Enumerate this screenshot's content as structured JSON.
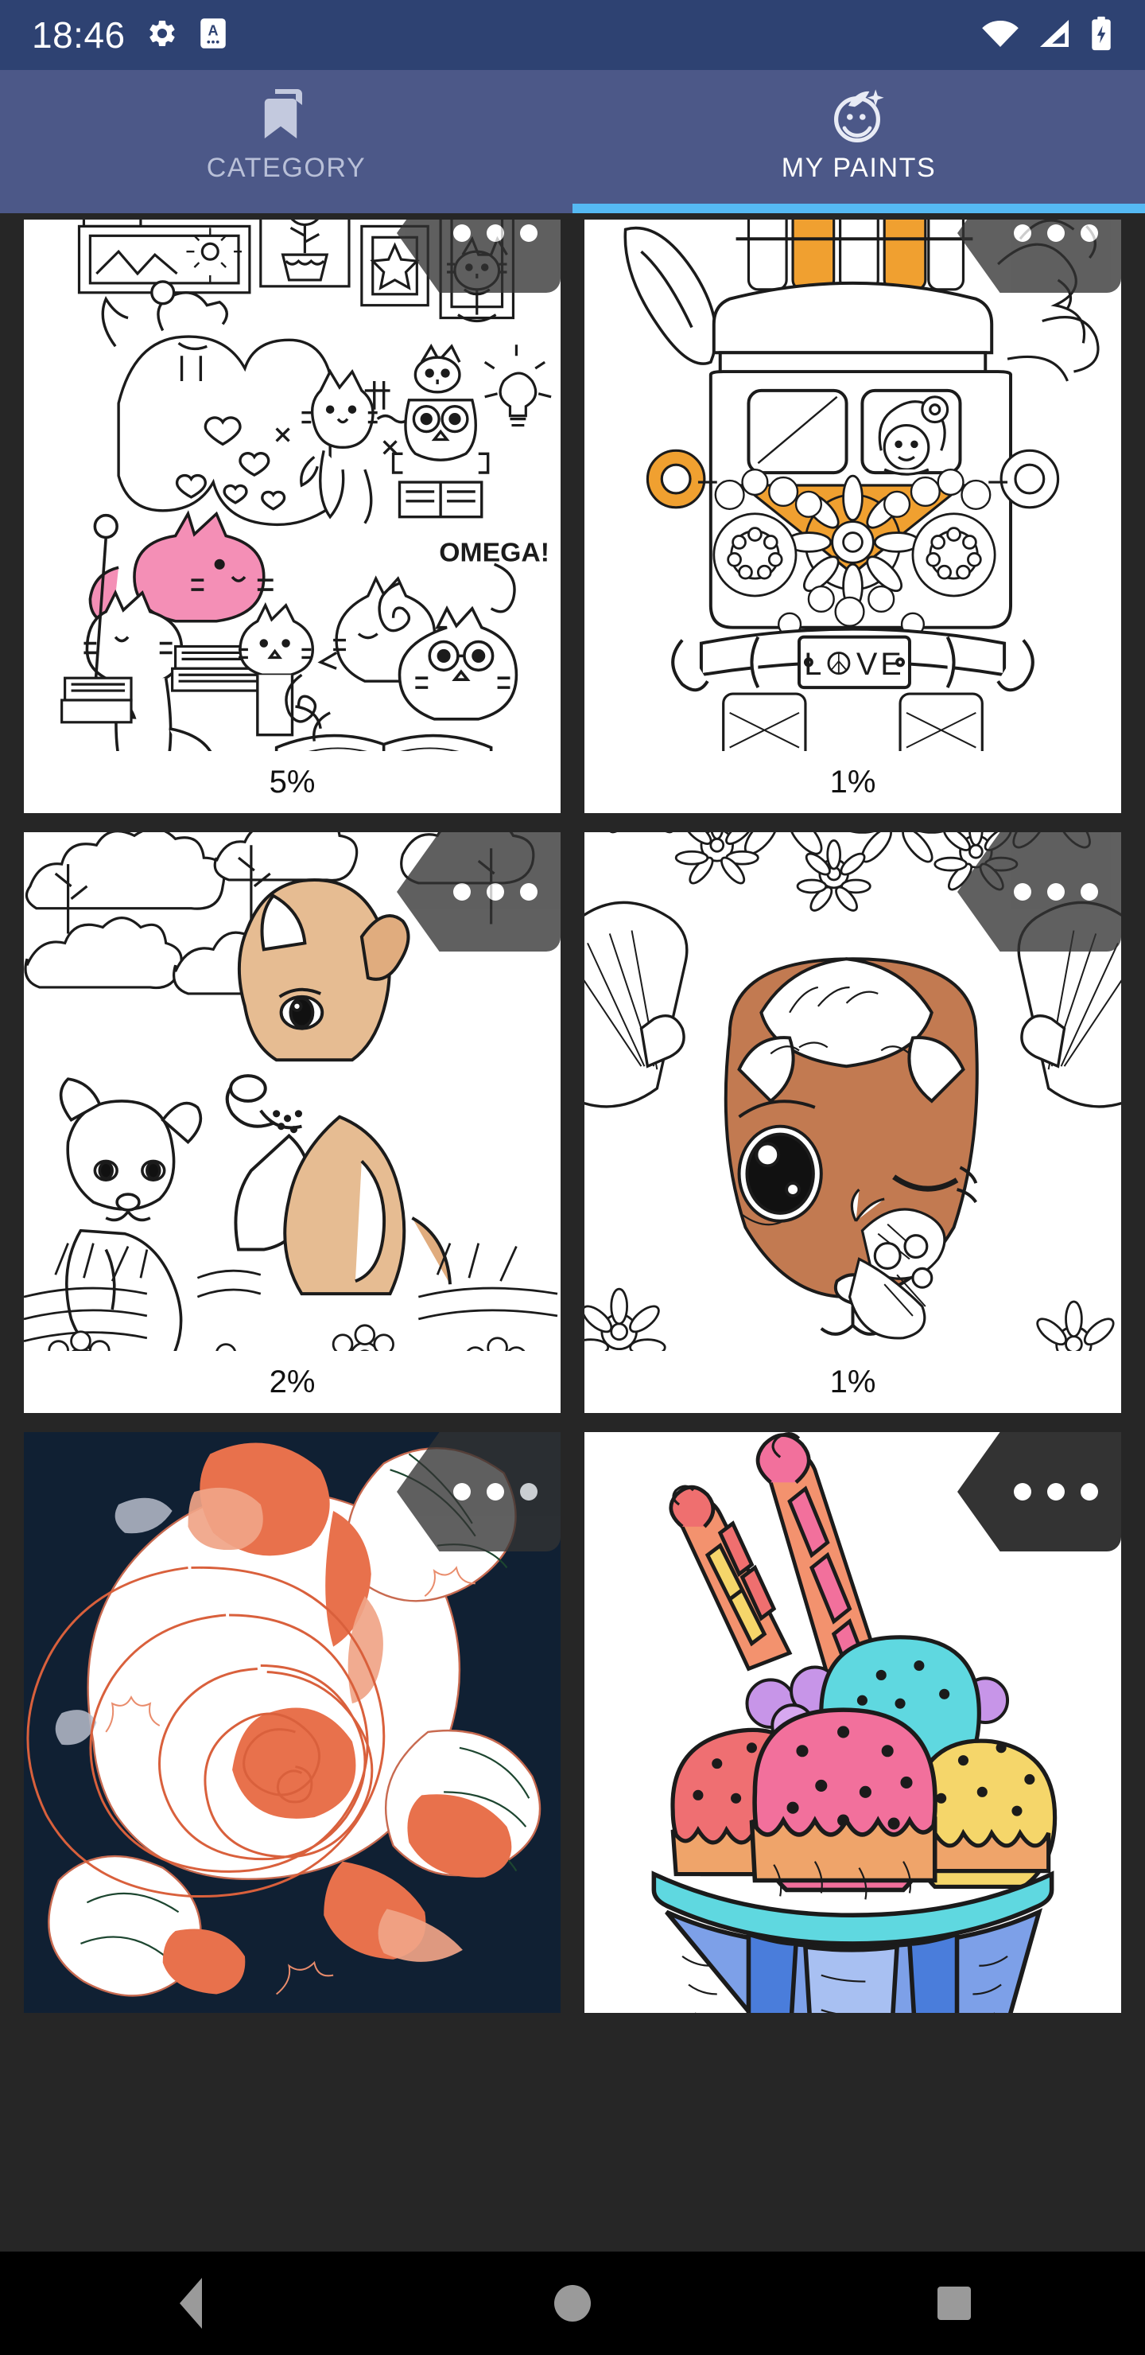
{
  "status_bar": {
    "clock": "18:46",
    "icons": [
      "gear-icon",
      "screenshot-icon",
      "wifi-icon",
      "cellular-signal-icon",
      "battery-charging-icon"
    ],
    "background_color": "#2e4272"
  },
  "tabs": {
    "background_color": "#4c5888",
    "active_indicator_color": "#55b9f3",
    "items": [
      {
        "label": "CATEGORY",
        "icon": "bookmark-icon",
        "active": false
      },
      {
        "label": "MY PAINTS",
        "icon": "face-sparkle-icon",
        "active": true
      }
    ]
  },
  "gallery": {
    "background_color": "#262626",
    "menu_icon": "overflow-dots-icon",
    "items": [
      {
        "id": "cats-bookshelf",
        "title": "Cats with books",
        "progress": "5%",
        "menu_opacity": "faded",
        "accent_color": "#f48fb6",
        "artwork_text": "OMEGA!"
      },
      {
        "id": "hippie-van",
        "title": "Hippie flower van",
        "progress": "1%",
        "menu_opacity": "faded",
        "accent_color": "#f0a030",
        "artwork_text": "LOVE"
      },
      {
        "id": "dog-puppies-meadow",
        "title": "Dogs in a meadow",
        "progress": "2%",
        "menu_opacity": "faded",
        "accent_color": "#e6bc92",
        "artwork_text": ""
      },
      {
        "id": "rabbit-butterfly-flowers",
        "title": "Rabbit with butterfly",
        "progress": "1%",
        "menu_opacity": "faded",
        "accent_color": "#c27a51",
        "artwork_text": ""
      },
      {
        "id": "rose-bloom",
        "title": "Rose on dark background",
        "progress": "",
        "menu_opacity": "faded",
        "accent_color": "#e8714c",
        "artwork_text": ""
      },
      {
        "id": "ice-cream-sundae",
        "title": "Ice cream sundae",
        "progress": "",
        "menu_opacity": "solid",
        "accent_color": "#f2609a",
        "artwork_text": ""
      }
    ]
  },
  "nav_bar": {
    "background_color": "#000000",
    "buttons": [
      {
        "name": "back",
        "icon": "triangle-back-icon"
      },
      {
        "name": "home",
        "icon": "circle-home-icon"
      },
      {
        "name": "recents",
        "icon": "square-recents-icon"
      }
    ]
  }
}
